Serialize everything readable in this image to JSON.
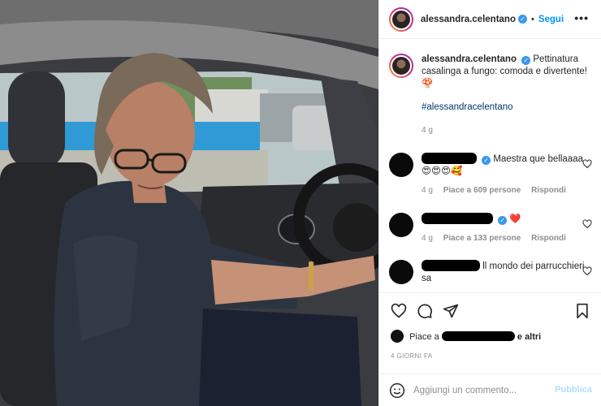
{
  "post": {
    "username": "alessandra.celentano",
    "follow_label": "Segui",
    "separator": "•",
    "more_label": "•••",
    "caption": "Pettinatura casalinga a fungo: comoda e divertente!",
    "caption_emoji": "🍄",
    "hashtag": "#alessandracelentano",
    "caption_time": "4 g",
    "likes_prefix": "Piace a",
    "likes_suffix": "e altri",
    "date": "4 GIORNI FA"
  },
  "comments": [
    {
      "text_tail": "Maestra que bellaaaa 😍😍😍🥰",
      "time": "4 g",
      "likes": "Piace a 609 persone",
      "reply": "Rispondi"
    },
    {
      "text_tail": "❤️",
      "time": "4 g",
      "likes": "Piace a 133 persone",
      "reply": "Rispondi"
    },
    {
      "text_tail": "ll mondo dei parrucchieri sa"
    }
  ],
  "add_comment": {
    "placeholder": "Aggiungi un commento...",
    "publish_label": "Pubblica"
  },
  "colors": {
    "link_blue": "#0095f6",
    "hashtag_blue": "#00376b",
    "meta_gray": "#8e8e8e",
    "publish_disabled": "#b2dffc",
    "verified_blue": "#3897f0"
  },
  "icons": [
    "more-options-icon",
    "heart-icon",
    "comment-icon",
    "share-icon",
    "bookmark-icon",
    "emoji-icon",
    "verified-badge-icon"
  ]
}
